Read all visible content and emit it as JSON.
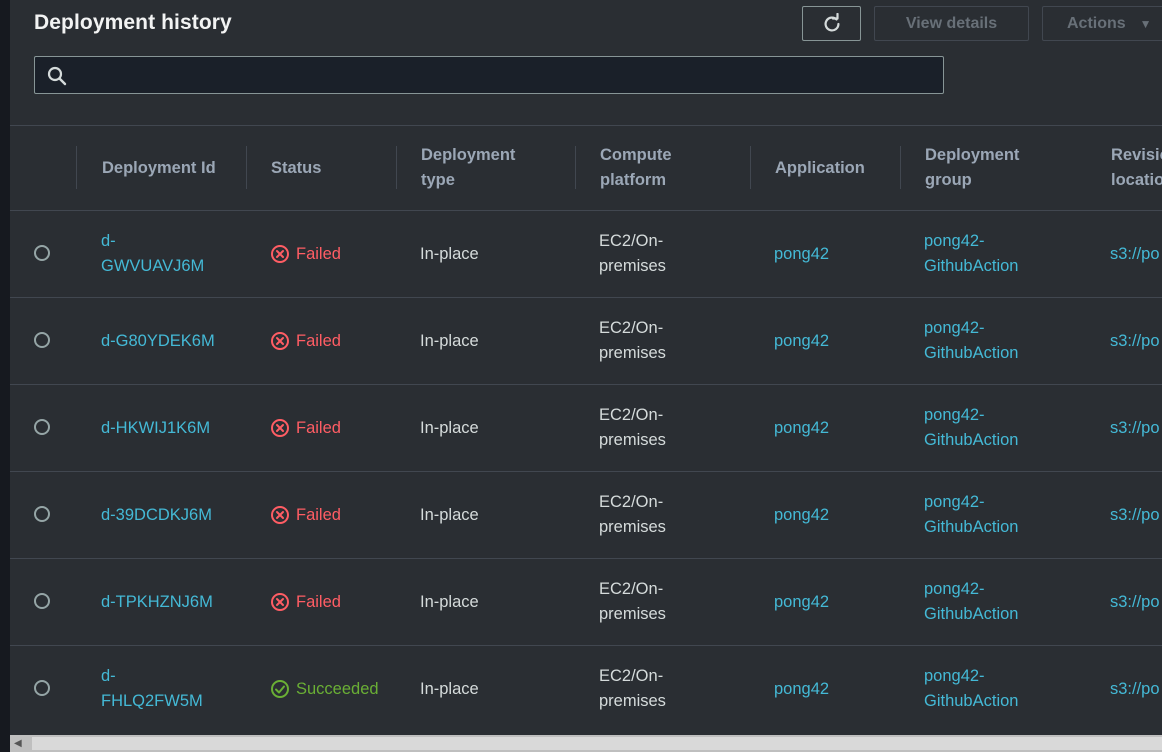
{
  "header": {
    "title": "Deployment history",
    "view_details_label": "View details",
    "actions_label": "Actions"
  },
  "search": {
    "value": "",
    "placeholder": ""
  },
  "columns": [
    "Deployment Id",
    "Status",
    "Deployment type",
    "Compute platform",
    "Application",
    "Deployment group",
    "Revision location"
  ],
  "rows": [
    {
      "id": "d-GWVUAVJ6M",
      "status": "Failed",
      "type": "In-place",
      "platform": "EC2/On-premises",
      "application": "pong42",
      "group": "pong42-GithubAction",
      "revision": "s3://po"
    },
    {
      "id": "d-G80YDEK6M",
      "status": "Failed",
      "type": "In-place",
      "platform": "EC2/On-premises",
      "application": "pong42",
      "group": "pong42-GithubAction",
      "revision": "s3://po"
    },
    {
      "id": "d-HKWIJ1K6M",
      "status": "Failed",
      "type": "In-place",
      "platform": "EC2/On-premises",
      "application": "pong42",
      "group": "pong42-GithubAction",
      "revision": "s3://po"
    },
    {
      "id": "d-39DCDKJ6M",
      "status": "Failed",
      "type": "In-place",
      "platform": "EC2/On-premises",
      "application": "pong42",
      "group": "pong42-GithubAction",
      "revision": "s3://po"
    },
    {
      "id": "d-TPKHZNJ6M",
      "status": "Failed",
      "type": "In-place",
      "platform": "EC2/On-premises",
      "application": "pong42",
      "group": "pong42-GithubAction",
      "revision": "s3://po"
    },
    {
      "id": "d-FHLQ2FW5M",
      "status": "Succeeded",
      "type": "In-place",
      "platform": "EC2/On-premises",
      "application": "pong42",
      "group": "pong42-GithubAction",
      "revision": "s3://po"
    }
  ],
  "colors": {
    "link": "#44b9d6",
    "failed": "#ff5d64",
    "succeeded": "#6aaf35",
    "background": "#2a2e33"
  },
  "icons": {
    "refresh": "refresh-icon",
    "search": "search-icon",
    "actions_caret": "caret-down-icon",
    "failed": "failed-icon",
    "succeeded": "success-icon"
  }
}
